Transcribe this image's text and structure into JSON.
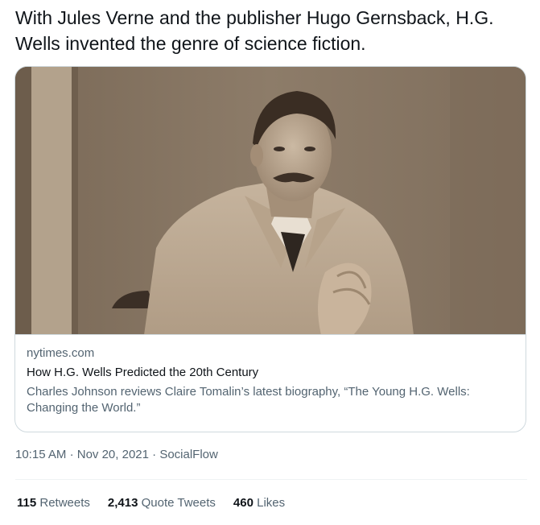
{
  "tweet": {
    "text": "With Jules Verne and the publisher Hugo Gernsback, H.G. Wells invented the genre of science fiction."
  },
  "card": {
    "domain": "nytimes.com",
    "title": "How H.G. Wells Predicted the 20th Century",
    "description": "Charles Johnson reviews Claire Tomalin’s latest biography, “The Young H.G. Wells: Changing the World.”"
  },
  "meta": {
    "time": "10:15 AM",
    "date": "Nov 20, 2021",
    "source": "SocialFlow",
    "separator": "·"
  },
  "stats": {
    "retweets_count": "115",
    "retweets_label": "Retweets",
    "quotes_count": "2,413",
    "quotes_label": "Quote Tweets",
    "likes_count": "460",
    "likes_label": "Likes"
  },
  "colors": {
    "text_primary": "#0f1419",
    "text_secondary": "#536471",
    "border": "#cfd9de"
  }
}
